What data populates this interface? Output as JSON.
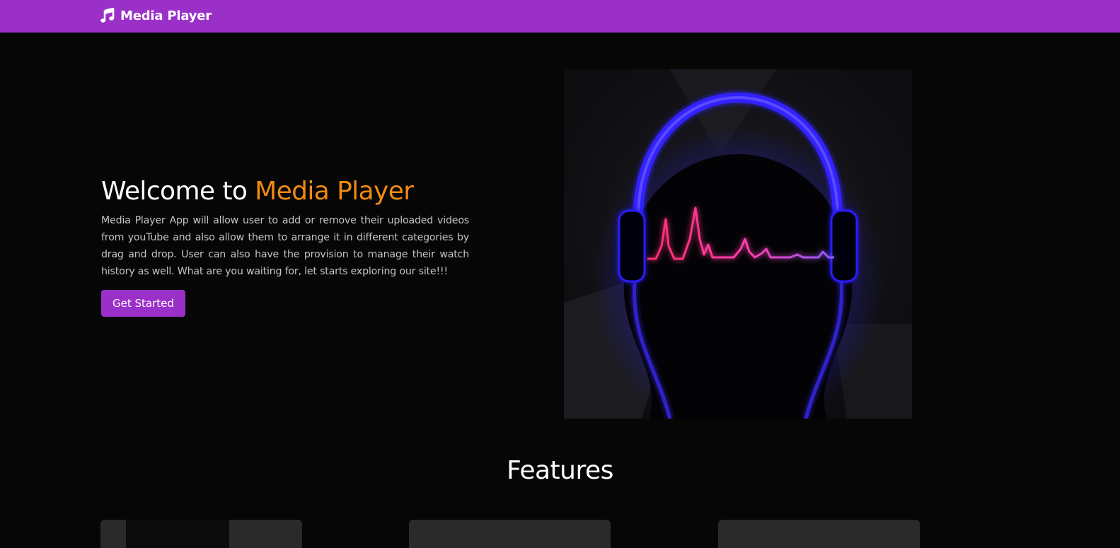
{
  "navbar": {
    "brand_icon": "music-note-icon",
    "brand_label": "Media Player",
    "background": "#9b30c9"
  },
  "hero": {
    "title_prefix": "Welcome to ",
    "title_accent": "Media Player",
    "accent_color": "#f08a12",
    "description": "Media Player App will allow user to add or remove their uploaded videos from youTube and also allow them to arrange it in different categories by drag and drop. User can also have the provision to manage their watch history as well. What are you waiting for, let starts exploring our site!!!",
    "cta_label": "Get Started",
    "image_subject": "headphones-waveform-illustration"
  },
  "features": {
    "title": "Features",
    "card_count_visible": 3
  }
}
